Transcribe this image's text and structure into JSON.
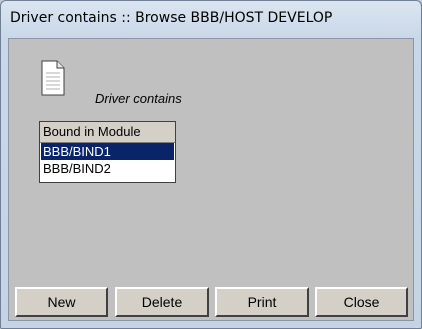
{
  "window": {
    "title": "Driver contains :: Browse BBB/HOST DEVELOP"
  },
  "content": {
    "caption": "Driver contains",
    "icon": "document-icon"
  },
  "list": {
    "header": "Bound in Module",
    "rows": [
      {
        "label": "BBB/BIND1",
        "selected": true
      },
      {
        "label": "BBB/BIND2",
        "selected": false
      }
    ]
  },
  "buttons": {
    "new": "New",
    "delete": "Delete",
    "print": "Print",
    "close": "Close"
  },
  "colors": {
    "selection": "#0a246a",
    "face": "#c0c0c0"
  }
}
